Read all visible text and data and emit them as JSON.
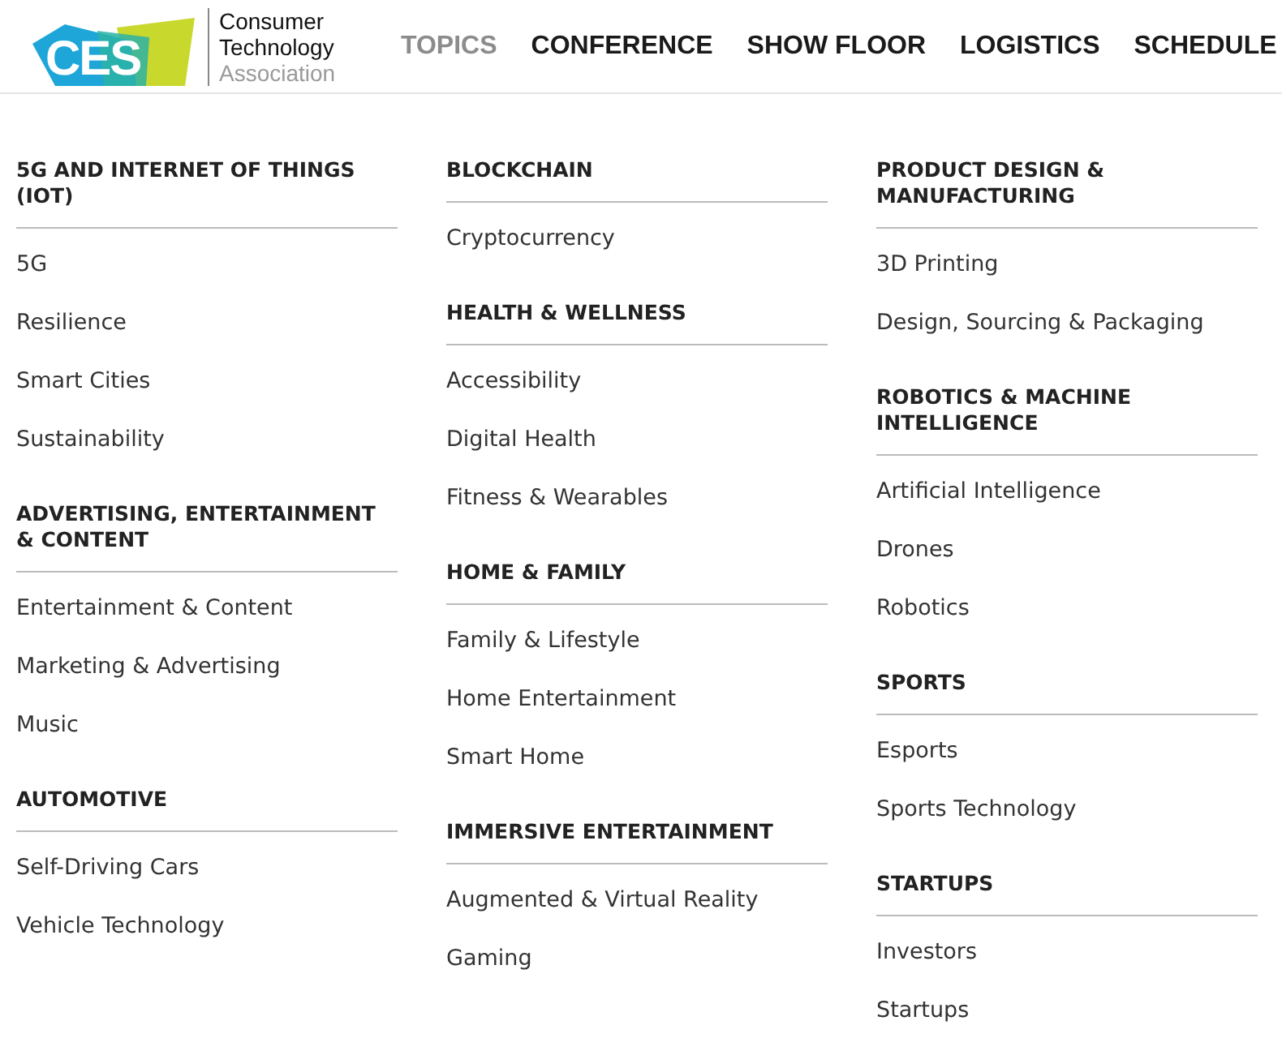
{
  "logo": {
    "mark": "CES",
    "org_lines": [
      "Consumer",
      "Technology",
      "Association"
    ]
  },
  "nav": [
    {
      "label": "TOPICS",
      "selected": true
    },
    {
      "label": "CONFERENCE",
      "selected": false
    },
    {
      "label": "SHOW FLOOR",
      "selected": false
    },
    {
      "label": "LOGISTICS",
      "selected": false
    },
    {
      "label": "SCHEDULE",
      "selected": false
    }
  ],
  "columns": [
    [
      {
        "heading": "5G AND INTERNET OF THINGS (IOT)",
        "items": [
          "5G",
          "Resilience",
          "Smart Cities",
          "Sustainability"
        ]
      },
      {
        "heading": "ADVERTISING, ENTERTAINMENT & CONTENT",
        "items": [
          "Entertainment & Content",
          "Marketing & Advertising",
          "Music"
        ]
      },
      {
        "heading": "AUTOMOTIVE",
        "items": [
          "Self-Driving Cars",
          "Vehicle Technology"
        ]
      }
    ],
    [
      {
        "heading": "BLOCKCHAIN",
        "items": [
          "Cryptocurrency"
        ]
      },
      {
        "heading": "HEALTH & WELLNESS",
        "items": [
          "Accessibility",
          "Digital Health",
          "Fitness & Wearables"
        ]
      },
      {
        "heading": "HOME & FAMILY",
        "items": [
          "Family & Lifestyle",
          "Home Entertainment",
          "Smart Home"
        ]
      },
      {
        "heading": "IMMERSIVE ENTERTAINMENT",
        "items": [
          "Augmented & Virtual Reality",
          "Gaming"
        ]
      }
    ],
    [
      {
        "heading": "PRODUCT DESIGN & MANUFACTURING",
        "items": [
          "3D Printing",
          "Design, Sourcing & Packaging"
        ]
      },
      {
        "heading": "ROBOTICS & MACHINE INTELLIGENCE",
        "items": [
          "Artificial Intelligence",
          "Drones",
          "Robotics"
        ]
      },
      {
        "heading": "SPORTS",
        "items": [
          "Esports",
          "Sports Technology"
        ]
      },
      {
        "heading": "STARTUPS",
        "items": [
          "Investors",
          "Startups"
        ]
      }
    ]
  ]
}
